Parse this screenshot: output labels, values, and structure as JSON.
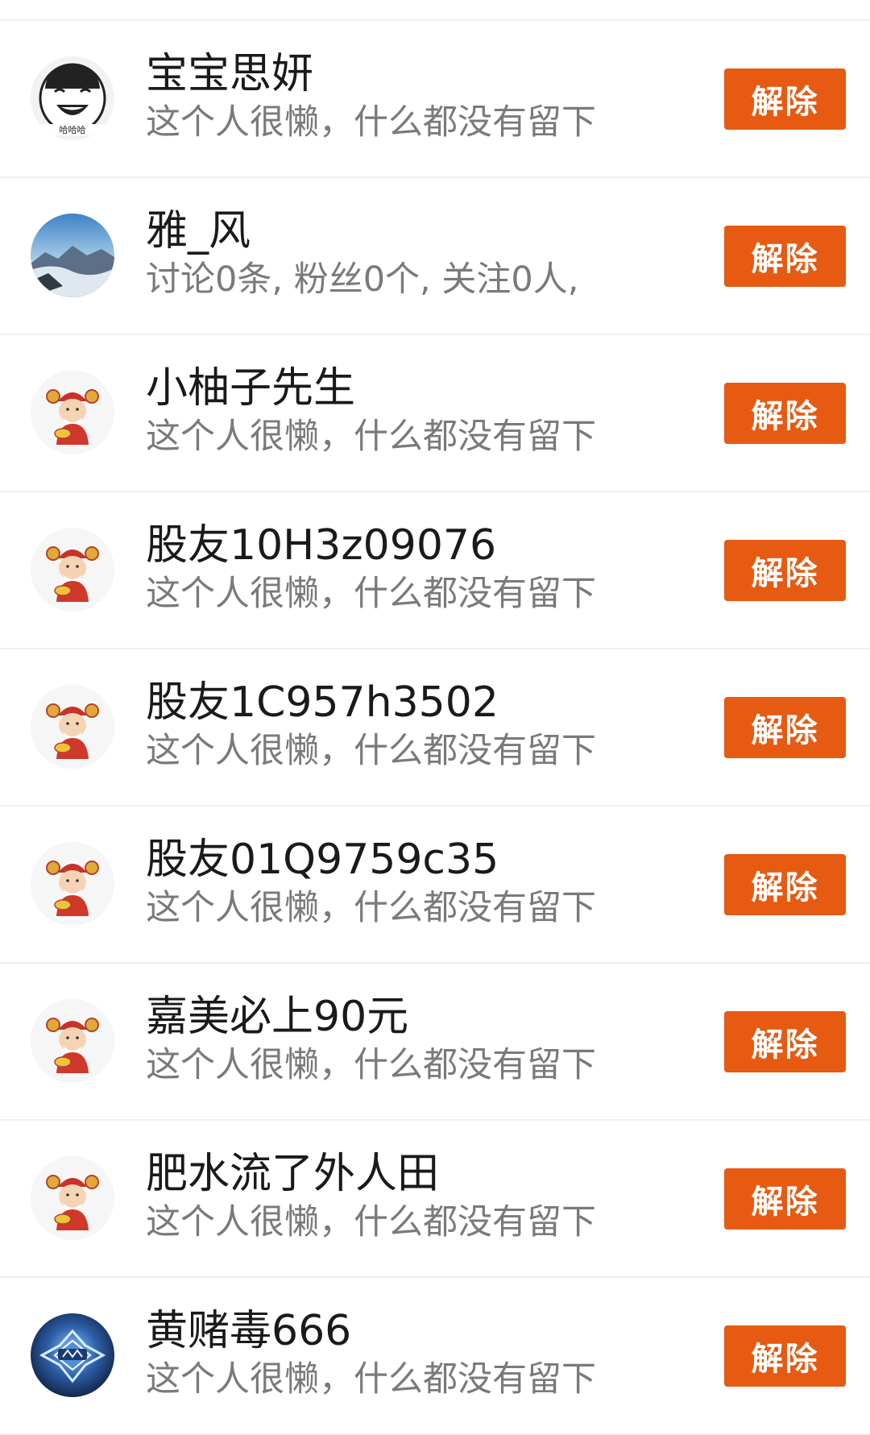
{
  "accent_color": "#e65a12",
  "users": [
    {
      "name": "宝宝思妍",
      "desc": "这个人很懒，什么都没有留下",
      "avatar": "meme-face-avatar",
      "action": "解除"
    },
    {
      "name": "雅_风",
      "desc": "讨论0条, 粉丝0个, 关注0人,",
      "avatar": "mountain-photo-avatar",
      "action": "解除"
    },
    {
      "name": "小柚子先生",
      "desc": "这个人很懒，什么都没有留下",
      "avatar": "fortune-god-avatar",
      "action": "解除"
    },
    {
      "name": "股友10H3z09076",
      "desc": "这个人很懒，什么都没有留下",
      "avatar": "fortune-god-avatar",
      "action": "解除"
    },
    {
      "name": "股友1C957h3502",
      "desc": "这个人很懒，什么都没有留下",
      "avatar": "fortune-god-avatar",
      "action": "解除"
    },
    {
      "name": "股友01Q9759c35",
      "desc": "这个人很懒，什么都没有留下",
      "avatar": "fortune-god-avatar",
      "action": "解除"
    },
    {
      "name": "嘉美必上90元",
      "desc": "这个人很懒，什么都没有留下",
      "avatar": "fortune-god-avatar",
      "action": "解除"
    },
    {
      "name": "肥水流了外人田",
      "desc": "这个人很懒，什么都没有留下",
      "avatar": "fortune-god-avatar",
      "action": "解除"
    },
    {
      "name": "黄赌毒666",
      "desc": "这个人很懒，什么都没有留下",
      "avatar": "game-emblem-avatar",
      "action": "解除"
    }
  ]
}
